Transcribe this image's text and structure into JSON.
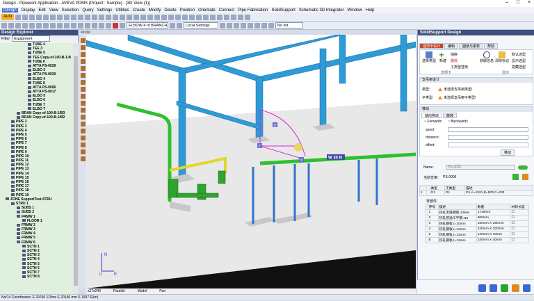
{
  "window": {
    "title": "Design - Pipework Application - AVEVA PDMS (Project : Sample) - [3D View (1)]"
  },
  "menu": [
    "Design",
    "Display",
    "Edit",
    "View",
    "Selection",
    "Query",
    "Settings",
    "Utilities",
    "Create",
    "Modify",
    "Delete",
    "Position",
    "Orientate",
    "Connect",
    "Pipe Fabrication",
    "SolidSupport",
    "Schematic 3D Integrator",
    "Window",
    "Help"
  ],
  "toolbar": {
    "auto_label": "Auto",
    "element_combo": "ELBOW 4 of BRANCH /Copy-",
    "settings_combo": "Local Settings",
    "list_combo": "No list"
  },
  "explorer": {
    "title": "Design Explorer",
    "filter_label": "Filter",
    "filter_value": "Equipment",
    "items": [
      {
        "label": "TUBE 4",
        "indent": 5
      },
      {
        "label": "TEE 3",
        "indent": 5
      },
      {
        "label": "TUBE 5",
        "indent": 5
      },
      {
        "label": "TEE Copy-of-100-B-1-B",
        "indent": 5
      },
      {
        "label": "TUBE 6",
        "indent": 5
      },
      {
        "label": "ATTA PS-0029",
        "indent": 5
      },
      {
        "label": "ELBO 3",
        "indent": 5
      },
      {
        "label": "ATTA PS-0030",
        "indent": 5
      },
      {
        "label": "ELBO 4",
        "indent": 5
      },
      {
        "label": "TUBE 8",
        "indent": 5
      },
      {
        "label": "ATTA PS-0006",
        "indent": 5
      },
      {
        "label": "ATTA PS-0017",
        "indent": 5
      },
      {
        "label": "ELBO 5",
        "indent": 5
      },
      {
        "label": "ELBO 6",
        "indent": 5
      },
      {
        "label": "TUBE 7",
        "indent": 5
      },
      {
        "label": "ELBO 7",
        "indent": 5
      },
      {
        "label": "BRAN Copy-of-100-B-1/B3",
        "indent": 3
      },
      {
        "label": "BRAN Copy-of-100-B-1/B2",
        "indent": 3
      },
      {
        "label": "PIPE 2",
        "indent": 2
      },
      {
        "label": "PIPE 3",
        "indent": 2
      },
      {
        "label": "PIPE 4",
        "indent": 2
      },
      {
        "label": "PIPE 5",
        "indent": 2
      },
      {
        "label": "PIPE 6",
        "indent": 2
      },
      {
        "label": "PIPE 7",
        "indent": 2
      },
      {
        "label": "PIPE 8",
        "indent": 2
      },
      {
        "label": "PIPE 9",
        "indent": 2
      },
      {
        "label": "PIPE 10",
        "indent": 2
      },
      {
        "label": "PIPE 11",
        "indent": 2
      },
      {
        "label": "PIPE 12",
        "indent": 2
      },
      {
        "label": "PIPE 13",
        "indent": 2
      },
      {
        "label": "PIPE 14",
        "indent": 2
      },
      {
        "label": "PIPE 15",
        "indent": 2
      },
      {
        "label": "PIPE 16",
        "indent": 2
      },
      {
        "label": "PIPE 17",
        "indent": 2
      },
      {
        "label": "PIPE 18",
        "indent": 2
      },
      {
        "label": "PIPE 19",
        "indent": 2
      },
      {
        "label": "ZONE SupportTest-STRU",
        "indent": 1
      },
      {
        "label": "STRU 1",
        "indent": 2
      },
      {
        "label": "SUBS 1",
        "indent": 3
      },
      {
        "label": "SUBS 2",
        "indent": 3
      },
      {
        "label": "FRMW 1",
        "indent": 3
      },
      {
        "label": "FLOOR 1",
        "indent": 4
      },
      {
        "label": "FRMW 2",
        "indent": 3
      },
      {
        "label": "FRMW 3",
        "indent": 3
      },
      {
        "label": "FRMW 4",
        "indent": 3
      },
      {
        "label": "FRMW 5",
        "indent": 3
      },
      {
        "label": "FRMW 6",
        "indent": 3
      },
      {
        "label": "SCTN 1",
        "indent": 4
      },
      {
        "label": "SCTN 2",
        "indent": 4
      },
      {
        "label": "SCTN 3",
        "indent": 4
      },
      {
        "label": "SCTN 4",
        "indent": 4
      },
      {
        "label": "SCTN 5",
        "indent": 4
      },
      {
        "label": "SCTN 6",
        "indent": 4
      },
      {
        "label": "SCTN 7",
        "indent": 4
      },
      {
        "label": "SCTN 8",
        "indent": 4
      }
    ]
  },
  "viewport": {
    "mode_label": "Model",
    "axis_x": "E",
    "axis_y": "N",
    "axis_z": "U",
    "marker_x": "X",
    "marker_z": "Z",
    "marker_y": "Y",
    "dimension_tag": "W 30 N",
    "status": [
      "s37x240",
      "Parallel",
      "Model",
      "Pan"
    ]
  },
  "ssd": {
    "title": "SolidSupport Design",
    "tabs": [
      "选项卡设计",
      "编辑",
      "图纸与报表",
      "帮助"
    ],
    "ribbon": {
      "select_type": "选择类型",
      "new": "新建",
      "insert": "插拼",
      "delete": "删除",
      "sub_type_replace": "子类型替换",
      "group_label": "选项卡",
      "get_info": "获取信息",
      "clear_mark": "清除标记",
      "default_select": "默认选型",
      "show_type": "显示选型",
      "hide_type": "隐藏选型",
      "display_group": "显示"
    },
    "support_section": {
      "title": "支吊架设计",
      "type_label": "类型:",
      "type_msg": "未选择支吊架类型!",
      "subtype_label": "子类型:",
      "subtype_msg": "未选择支吊架子类型!"
    },
    "move_section": {
      "title": "移动",
      "tabs": [
        "轴向移动",
        "旋转"
      ],
      "forwards": "Forwards",
      "backwards": "Backwards",
      "spool": "spool:",
      "distance": "distance:",
      "offset": "offset:",
      "move_btn": "移动"
    },
    "name_label": "Name:",
    "name_value": "PS-0031",
    "current_label": "当前支架:",
    "current_value": "PS-0006",
    "main_table": {
      "headers": [
        "",
        "",
        "类型",
        "子类型",
        "描述"
      ],
      "row": [
        "1",
        "",
        "G1",
        "G1",
        "G1,A=1931,B=500,C=400"
      ]
    },
    "parts_label": "零部件:",
    "parts_table": {
      "headers": [
        "",
        "序号",
        "描述",
        "数量",
        "材料长度"
      ],
      "rows": [
        [
          "1",
          "热轧无缝钢管,108x6",
          "1749mm"
        ],
        [
          "2",
          "热轧普通工字钢,I16",
          "900mm"
        ],
        [
          "3",
          "热轧钢板,t=10mm",
          "150mm X 150mm"
        ],
        [
          "4",
          "热轧钢板,t=12mm",
          "220mm X 220mm"
        ],
        [
          "5",
          "热轧钢板,t=12mm",
          "140mm X 40mm"
        ],
        [
          "6",
          "热轧钢板,t=12mm",
          "140mm X 40mm"
        ]
      ]
    }
  },
  "statusbar": {
    "text": "No/14 Coordinates:  E 29740  119ms  E 20146 mm  S 1907  El(m)"
  }
}
